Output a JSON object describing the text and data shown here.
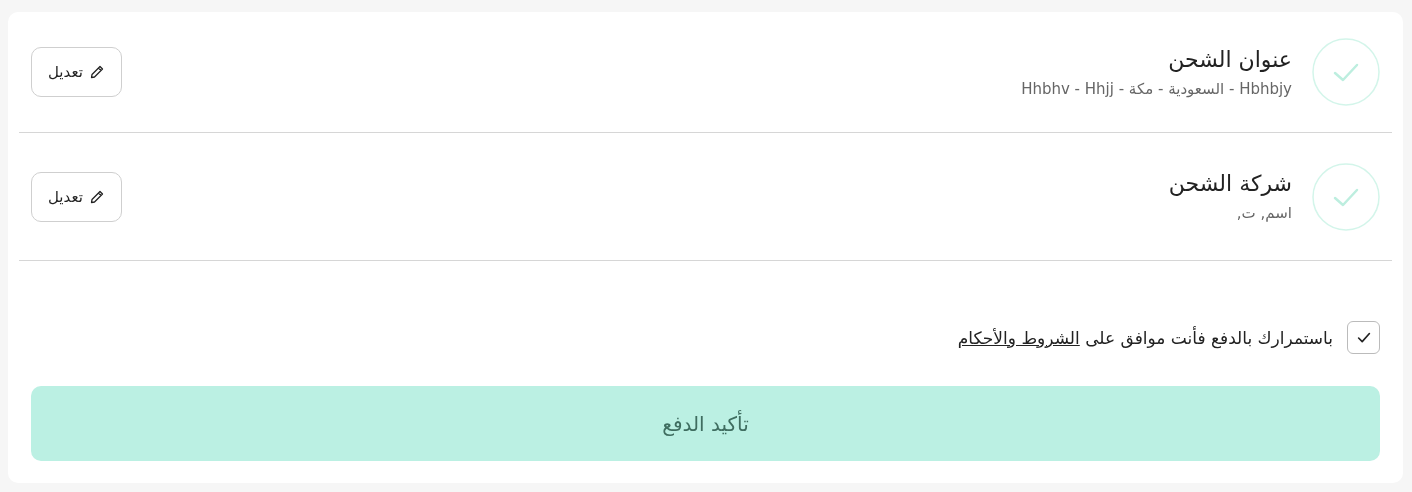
{
  "steps": [
    {
      "title": "عنوان الشحن",
      "detail": "Hbhbjy - السعودية - مكة - Hhbhv - Hhjj",
      "completed": true,
      "edit_label": "تعديل"
    },
    {
      "title": "شركة الشحن",
      "detail": "اسم, ت,",
      "completed": true,
      "edit_label": "تعديل"
    }
  ],
  "terms": {
    "checked": true,
    "text": "باستمرارك بالدفع فأنت موافق على",
    "link": "الشروط والأحكام"
  },
  "confirm_button": {
    "label": "تأكيد الدفع",
    "disabled": true
  }
}
